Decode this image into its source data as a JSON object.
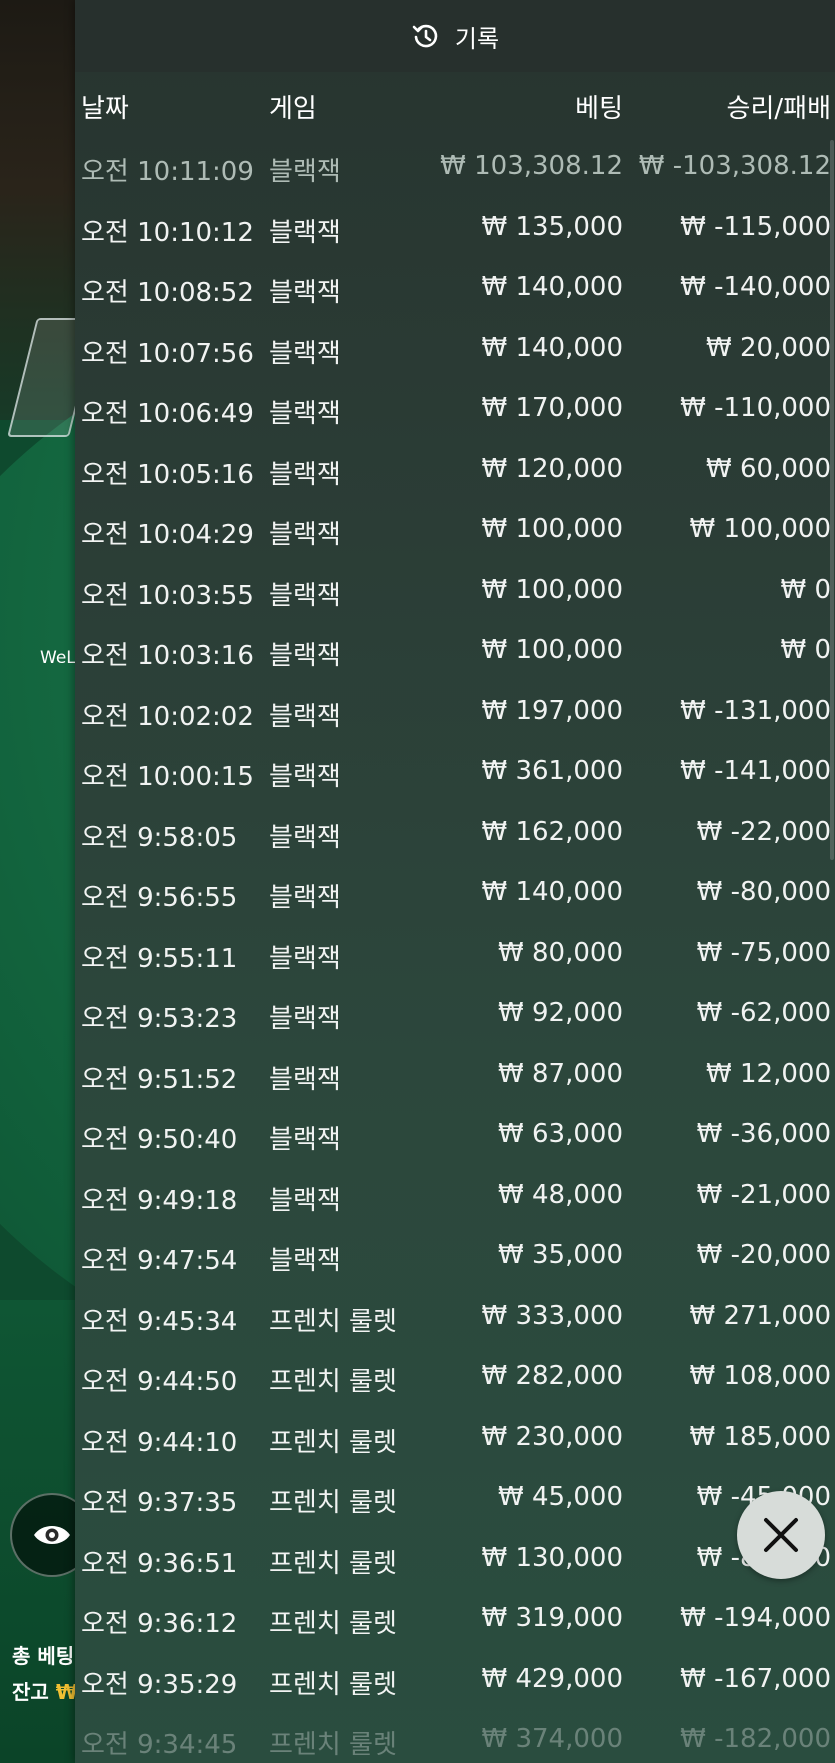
{
  "panel": {
    "title": "기록",
    "headers": {
      "date": "날짜",
      "game": "게임",
      "bet": "베팅",
      "win_loss": "승리/패배"
    }
  },
  "rows": [
    {
      "date": "오전 10:11:09",
      "game": "블랙잭",
      "bet": "₩ 103,308.12",
      "win_loss": "₩ -103,308.12"
    },
    {
      "date": "오전 10:10:12",
      "game": "블랙잭",
      "bet": "₩ 135,000",
      "win_loss": "₩ -115,000"
    },
    {
      "date": "오전 10:08:52",
      "game": "블랙잭",
      "bet": "₩ 140,000",
      "win_loss": "₩ -140,000"
    },
    {
      "date": "오전 10:07:56",
      "game": "블랙잭",
      "bet": "₩ 140,000",
      "win_loss": "₩ 20,000"
    },
    {
      "date": "오전 10:06:49",
      "game": "블랙잭",
      "bet": "₩ 170,000",
      "win_loss": "₩ -110,000"
    },
    {
      "date": "오전 10:05:16",
      "game": "블랙잭",
      "bet": "₩ 120,000",
      "win_loss": "₩ 60,000"
    },
    {
      "date": "오전 10:04:29",
      "game": "블랙잭",
      "bet": "₩ 100,000",
      "win_loss": "₩ 100,000"
    },
    {
      "date": "오전 10:03:55",
      "game": "블랙잭",
      "bet": "₩ 100,000",
      "win_loss": "₩ 0"
    },
    {
      "date": "오전 10:03:16",
      "game": "블랙잭",
      "bet": "₩ 100,000",
      "win_loss": "₩ 0"
    },
    {
      "date": "오전 10:02:02",
      "game": "블랙잭",
      "bet": "₩ 197,000",
      "win_loss": "₩ -131,000"
    },
    {
      "date": "오전 10:00:15",
      "game": "블랙잭",
      "bet": "₩ 361,000",
      "win_loss": "₩ -141,000"
    },
    {
      "date": "오전 9:58:05",
      "game": "블랙잭",
      "bet": "₩ 162,000",
      "win_loss": "₩ -22,000"
    },
    {
      "date": "오전 9:56:55",
      "game": "블랙잭",
      "bet": "₩ 140,000",
      "win_loss": "₩ -80,000"
    },
    {
      "date": "오전 9:55:11",
      "game": "블랙잭",
      "bet": "₩ 80,000",
      "win_loss": "₩ -75,000"
    },
    {
      "date": "오전 9:53:23",
      "game": "블랙잭",
      "bet": "₩ 92,000",
      "win_loss": "₩ -62,000"
    },
    {
      "date": "오전 9:51:52",
      "game": "블랙잭",
      "bet": "₩ 87,000",
      "win_loss": "₩ 12,000"
    },
    {
      "date": "오전 9:50:40",
      "game": "블랙잭",
      "bet": "₩ 63,000",
      "win_loss": "₩ -36,000"
    },
    {
      "date": "오전 9:49:18",
      "game": "블랙잭",
      "bet": "₩ 48,000",
      "win_loss": "₩ -21,000"
    },
    {
      "date": "오전 9:47:54",
      "game": "블랙잭",
      "bet": "₩ 35,000",
      "win_loss": "₩ -20,000"
    },
    {
      "date": "오전 9:45:34",
      "game": "프렌치 룰렛",
      "bet": "₩ 333,000",
      "win_loss": "₩ 271,000"
    },
    {
      "date": "오전 9:44:50",
      "game": "프렌치 룰렛",
      "bet": "₩ 282,000",
      "win_loss": "₩ 108,000"
    },
    {
      "date": "오전 9:44:10",
      "game": "프렌치 룰렛",
      "bet": "₩ 230,000",
      "win_loss": "₩ 185,000"
    },
    {
      "date": "오전 9:37:35",
      "game": "프렌치 룰렛",
      "bet": "₩ 45,000",
      "win_loss": "₩ -45,000"
    },
    {
      "date": "오전 9:36:51",
      "game": "프렌치 룰렛",
      "bet": "₩ 130,000",
      "win_loss": "₩ -85,000"
    },
    {
      "date": "오전 9:36:12",
      "game": "프렌치 룰렛",
      "bet": "₩ 319,000",
      "win_loss": "₩ -194,000"
    },
    {
      "date": "오전 9:35:29",
      "game": "프렌치 룰렛",
      "bet": "₩ 429,000",
      "win_loss": "₩ -167,000"
    },
    {
      "date": "오전 9:34:45",
      "game": "프렌치 룰렛",
      "bet": "₩ 374,000",
      "win_loss": "₩ -182,000"
    }
  ],
  "background": {
    "welcome_text": "WeL",
    "total_bet_label": "총 베팅",
    "balance_label": "잔고",
    "balance_currency": "₩"
  },
  "icons": {
    "header": "history-icon",
    "close": "close-icon",
    "view": "eye-icon"
  }
}
